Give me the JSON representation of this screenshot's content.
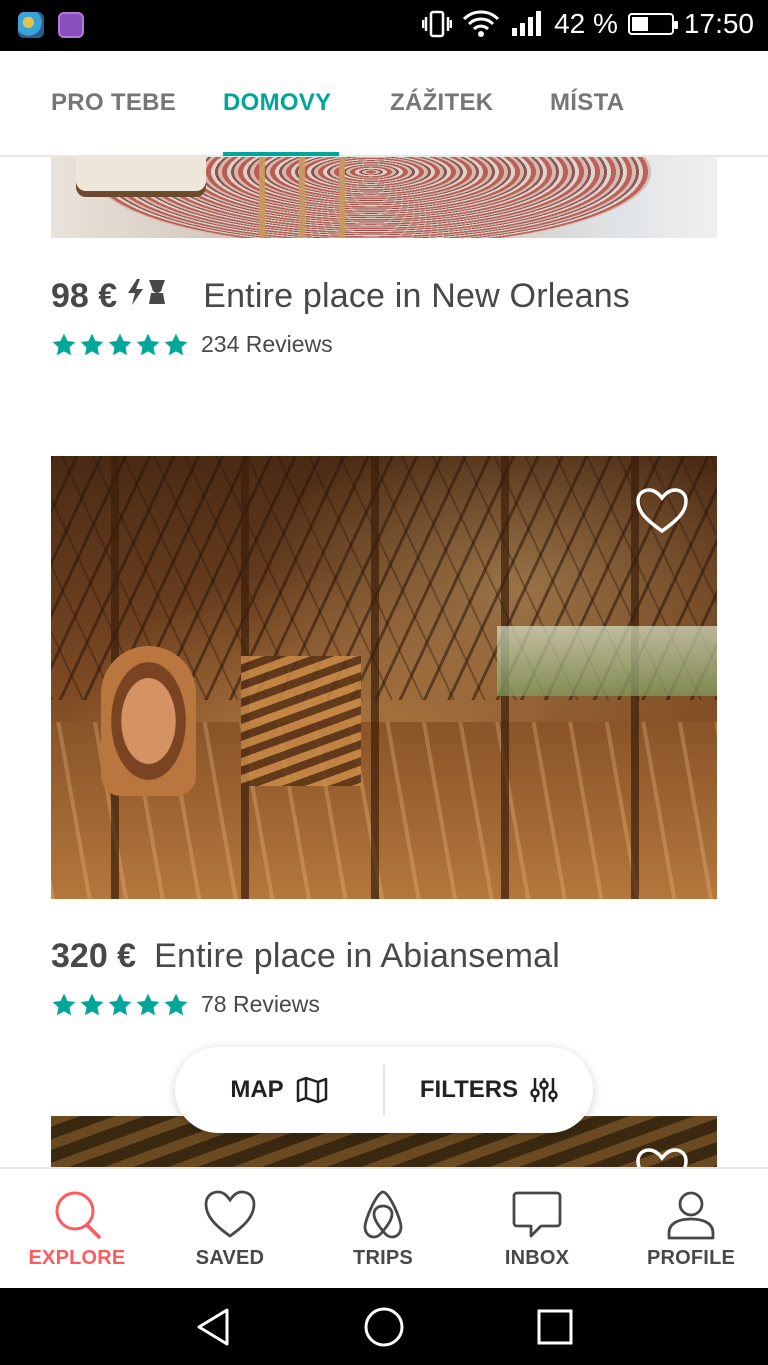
{
  "status_bar": {
    "battery_text": "42 %",
    "time": "17:50",
    "battery_level": 0.42,
    "icons": [
      "app-icon-1",
      "app-icon-2",
      "vibrate-icon",
      "wifi-icon",
      "signal-icon",
      "battery-icon"
    ]
  },
  "tabs": [
    {
      "label": "PRO TEBE",
      "active": false
    },
    {
      "label": "DOMOVY",
      "active": true
    },
    {
      "label": "ZÁŽITEK",
      "active": false
    },
    {
      "label": "MÍSTA",
      "active": false
    }
  ],
  "listings": [
    {
      "price": "98 €",
      "instant_book": true,
      "title": "Entire place in New Orleans",
      "stars": 5,
      "reviews": "234 Reviews"
    },
    {
      "price": "320 €",
      "instant_book": false,
      "title": "Entire place in Abiansemal",
      "stars": 5,
      "reviews": "78 Reviews"
    }
  ],
  "floating_bar": {
    "map_label": "MAP",
    "filters_label": "FILTERS"
  },
  "bottom_nav": [
    {
      "label": "EXPLORE",
      "icon": "search-icon",
      "active": true
    },
    {
      "label": "SAVED",
      "icon": "heart-icon",
      "active": false
    },
    {
      "label": "TRIPS",
      "icon": "trips-icon",
      "active": false
    },
    {
      "label": "INBOX",
      "icon": "inbox-icon",
      "active": false
    },
    {
      "label": "PROFILE",
      "icon": "profile-icon",
      "active": false
    }
  ],
  "colors": {
    "accent": "#00a699",
    "brand": "#ff5a5f",
    "text": "#484848",
    "star": "#00a699"
  }
}
